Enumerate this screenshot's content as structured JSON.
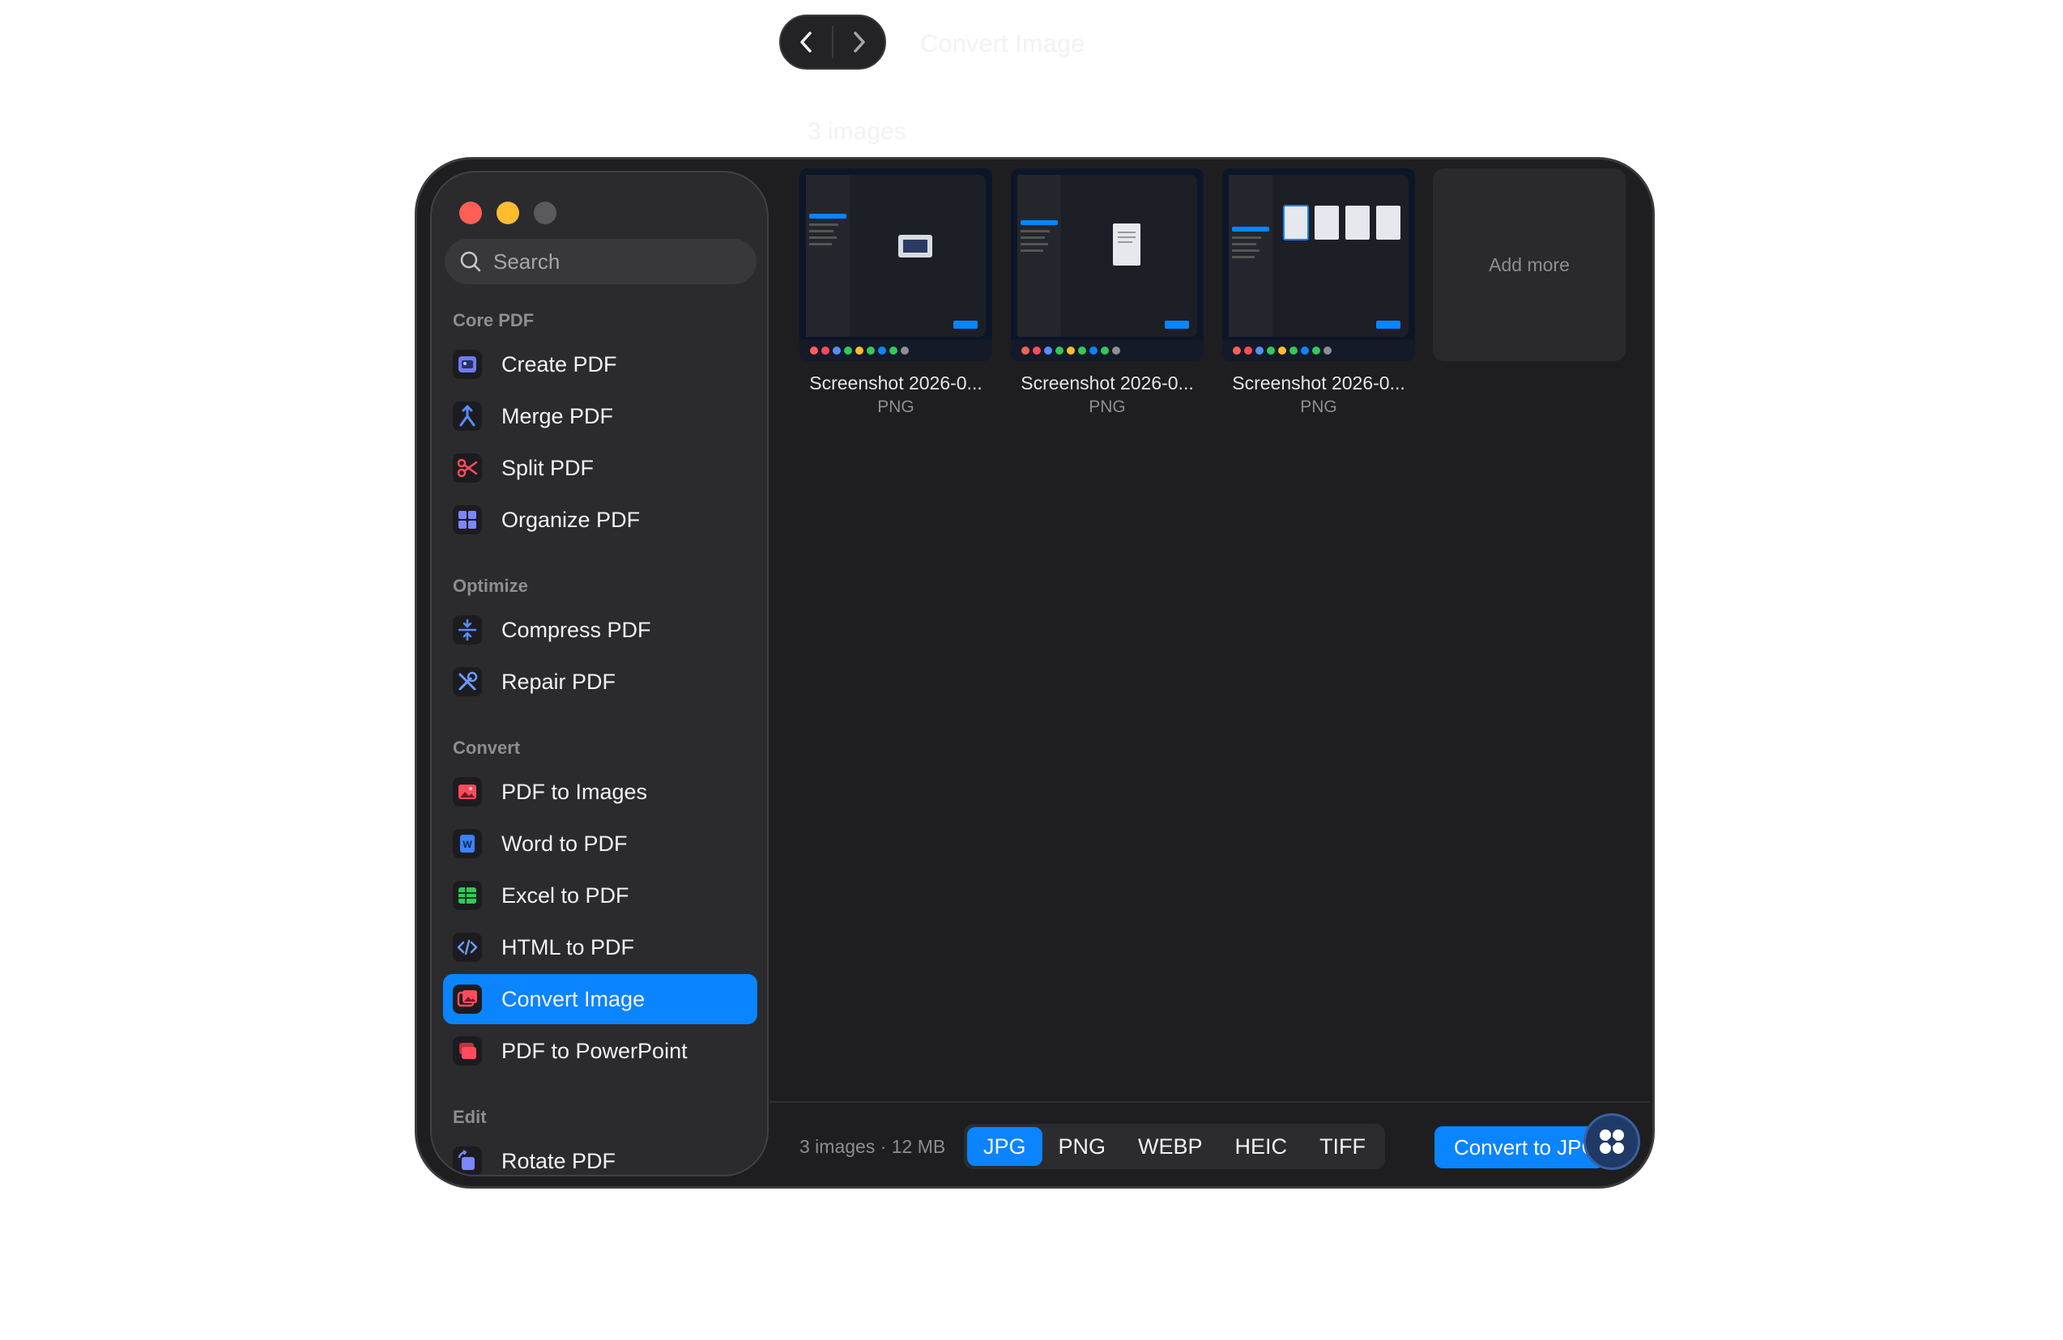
{
  "window": {
    "title": "Convert Image"
  },
  "search": {
    "placeholder": "Search"
  },
  "sidebar": {
    "sections": [
      {
        "label": "Core PDF",
        "items": [
          {
            "label": "Create PDF",
            "icon": "create-pdf-icon"
          },
          {
            "label": "Merge PDF",
            "icon": "merge-icon"
          },
          {
            "label": "Split PDF",
            "icon": "scissors-icon"
          },
          {
            "label": "Organize PDF",
            "icon": "grid-icon"
          }
        ]
      },
      {
        "label": "Optimize",
        "items": [
          {
            "label": "Compress PDF",
            "icon": "compress-icon"
          },
          {
            "label": "Repair PDF",
            "icon": "tools-icon"
          }
        ]
      },
      {
        "label": "Convert",
        "items": [
          {
            "label": "PDF to Images",
            "icon": "image-icon"
          },
          {
            "label": "Word to PDF",
            "icon": "word-icon"
          },
          {
            "label": "Excel to PDF",
            "icon": "spreadsheet-icon"
          },
          {
            "label": "HTML to PDF",
            "icon": "code-icon"
          },
          {
            "label": "Convert Image",
            "icon": "convert-image-icon",
            "active": true
          },
          {
            "label": "PDF to PowerPoint",
            "icon": "slides-icon"
          }
        ]
      },
      {
        "label": "Edit",
        "items": [
          {
            "label": "Rotate PDF",
            "icon": "rotate-icon"
          }
        ]
      }
    ]
  },
  "main": {
    "count_heading": "3 images",
    "images": [
      {
        "name": "Screenshot 2026-0...",
        "type": "PNG"
      },
      {
        "name": "Screenshot 2026-0...",
        "type": "PNG"
      },
      {
        "name": "Screenshot 2026-0...",
        "type": "PNG"
      }
    ],
    "add_more": "Add more"
  },
  "footer": {
    "info": "3 images · 12 MB",
    "formats": [
      "JPG",
      "PNG",
      "WEBP",
      "HEIC",
      "TIFF"
    ],
    "selected_format": "JPG",
    "convert_label": "Convert to JPG"
  },
  "colors": {
    "accent": "#0a84ff",
    "background": "#1e1e20",
    "sidebar": "#2b2b2e"
  }
}
